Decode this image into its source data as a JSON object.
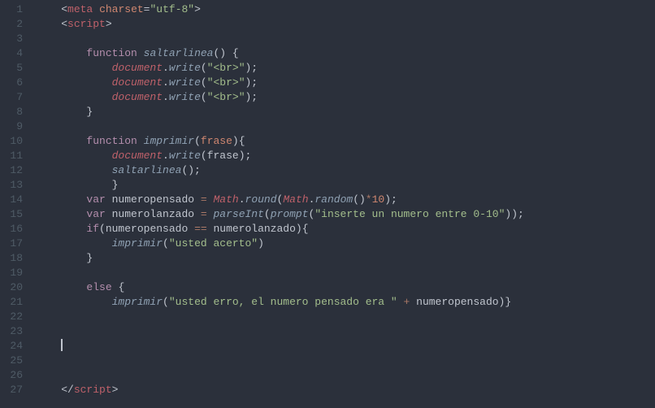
{
  "lineNumbers": [
    "1",
    "2",
    "3",
    "4",
    "5",
    "6",
    "7",
    "8",
    "9",
    "10",
    "11",
    "12",
    "13",
    "14",
    "15",
    "16",
    "17",
    "18",
    "19",
    "20",
    "21",
    "22",
    "23",
    "24",
    "25",
    "26",
    "27"
  ],
  "cursorLine": 24,
  "code": {
    "lines": [
      {
        "indent": 1,
        "tokens": [
          {
            "t": "<",
            "c": "punct"
          },
          {
            "t": "meta",
            "c": "tag"
          },
          {
            "t": " ",
            "c": "white"
          },
          {
            "t": "charset",
            "c": "attr"
          },
          {
            "t": "=",
            "c": "punct"
          },
          {
            "t": "\"utf-8\"",
            "c": "str"
          },
          {
            "t": ">",
            "c": "punct"
          }
        ]
      },
      {
        "indent": 1,
        "tokens": [
          {
            "t": "<",
            "c": "punct"
          },
          {
            "t": "script",
            "c": "tag"
          },
          {
            "t": ">",
            "c": "punct"
          }
        ]
      },
      {
        "indent": 0,
        "tokens": []
      },
      {
        "indent": 2,
        "tokens": [
          {
            "t": "function",
            "c": "kw"
          },
          {
            "t": " ",
            "c": "white"
          },
          {
            "t": "saltarlinea",
            "c": "fname"
          },
          {
            "t": "() {",
            "c": "punct"
          }
        ]
      },
      {
        "indent": 3,
        "tokens": [
          {
            "t": "document",
            "c": "obj"
          },
          {
            "t": ".",
            "c": "punct"
          },
          {
            "t": "write",
            "c": "prop"
          },
          {
            "t": "(",
            "c": "punct"
          },
          {
            "t": "\"<br>\"",
            "c": "str"
          },
          {
            "t": ");",
            "c": "punct"
          }
        ]
      },
      {
        "indent": 3,
        "tokens": [
          {
            "t": "document",
            "c": "obj"
          },
          {
            "t": ".",
            "c": "punct"
          },
          {
            "t": "write",
            "c": "prop"
          },
          {
            "t": "(",
            "c": "punct"
          },
          {
            "t": "\"<br>\"",
            "c": "str"
          },
          {
            "t": ");",
            "c": "punct"
          }
        ]
      },
      {
        "indent": 3,
        "tokens": [
          {
            "t": "document",
            "c": "obj"
          },
          {
            "t": ".",
            "c": "punct"
          },
          {
            "t": "write",
            "c": "prop"
          },
          {
            "t": "(",
            "c": "punct"
          },
          {
            "t": "\"<br>\"",
            "c": "str"
          },
          {
            "t": ");",
            "c": "punct"
          }
        ]
      },
      {
        "indent": 2,
        "tokens": [
          {
            "t": "}",
            "c": "punct"
          }
        ]
      },
      {
        "indent": 0,
        "tokens": []
      },
      {
        "indent": 2,
        "tokens": [
          {
            "t": "function",
            "c": "kw"
          },
          {
            "t": " ",
            "c": "white"
          },
          {
            "t": "imprimir",
            "c": "fname"
          },
          {
            "t": "(",
            "c": "punct"
          },
          {
            "t": "frase",
            "c": "param"
          },
          {
            "t": "){",
            "c": "punct"
          }
        ]
      },
      {
        "indent": 3,
        "tokens": [
          {
            "t": "document",
            "c": "obj"
          },
          {
            "t": ".",
            "c": "punct"
          },
          {
            "t": "write",
            "c": "prop"
          },
          {
            "t": "(",
            "c": "punct"
          },
          {
            "t": "frase",
            "c": "var"
          },
          {
            "t": ");",
            "c": "punct"
          }
        ]
      },
      {
        "indent": 3,
        "tokens": [
          {
            "t": "saltarlinea",
            "c": "fname"
          },
          {
            "t": "();",
            "c": "punct"
          }
        ]
      },
      {
        "indent": 3,
        "tokens": [
          {
            "t": "}",
            "c": "punct"
          }
        ]
      },
      {
        "indent": 2,
        "tokens": [
          {
            "t": "var",
            "c": "kw"
          },
          {
            "t": " numeropensado ",
            "c": "var"
          },
          {
            "t": "=",
            "c": "op"
          },
          {
            "t": " ",
            "c": "white"
          },
          {
            "t": "Math",
            "c": "obj"
          },
          {
            "t": ".",
            "c": "punct"
          },
          {
            "t": "round",
            "c": "prop"
          },
          {
            "t": "(",
            "c": "punct"
          },
          {
            "t": "Math",
            "c": "obj"
          },
          {
            "t": ".",
            "c": "punct"
          },
          {
            "t": "random",
            "c": "prop"
          },
          {
            "t": "()",
            "c": "punct"
          },
          {
            "t": "*",
            "c": "op"
          },
          {
            "t": "10",
            "c": "num"
          },
          {
            "t": ");",
            "c": "punct"
          }
        ]
      },
      {
        "indent": 2,
        "tokens": [
          {
            "t": "var",
            "c": "kw"
          },
          {
            "t": " numerolanzado ",
            "c": "var"
          },
          {
            "t": "=",
            "c": "op"
          },
          {
            "t": " ",
            "c": "white"
          },
          {
            "t": "parseInt",
            "c": "builtin"
          },
          {
            "t": "(",
            "c": "punct"
          },
          {
            "t": "prompt",
            "c": "builtin"
          },
          {
            "t": "(",
            "c": "punct"
          },
          {
            "t": "\"inserte un numero entre 0-10\"",
            "c": "str"
          },
          {
            "t": "));",
            "c": "punct"
          }
        ]
      },
      {
        "indent": 2,
        "tokens": [
          {
            "t": "if",
            "c": "kw"
          },
          {
            "t": "(numeropensado ",
            "c": "var"
          },
          {
            "t": "==",
            "c": "op"
          },
          {
            "t": " numerolanzado){",
            "c": "var"
          }
        ]
      },
      {
        "indent": 3,
        "tokens": [
          {
            "t": "imprimir",
            "c": "fname"
          },
          {
            "t": "(",
            "c": "punct"
          },
          {
            "t": "\"usted acerto\"",
            "c": "str"
          },
          {
            "t": ")",
            "c": "punct"
          }
        ]
      },
      {
        "indent": 2,
        "tokens": [
          {
            "t": "}",
            "c": "punct"
          }
        ]
      },
      {
        "indent": 0,
        "tokens": []
      },
      {
        "indent": 2,
        "tokens": [
          {
            "t": "else",
            "c": "kw"
          },
          {
            "t": " {",
            "c": "punct"
          }
        ]
      },
      {
        "indent": 3,
        "tokens": [
          {
            "t": "imprimir",
            "c": "fname"
          },
          {
            "t": "(",
            "c": "punct"
          },
          {
            "t": "\"usted erro, el numero pensado era \"",
            "c": "str"
          },
          {
            "t": " ",
            "c": "white"
          },
          {
            "t": "+",
            "c": "op"
          },
          {
            "t": " numeropensado)}",
            "c": "var"
          }
        ]
      },
      {
        "indent": 0,
        "tokens": []
      },
      {
        "indent": 0,
        "tokens": []
      },
      {
        "indent": 1,
        "tokens": [],
        "cursor": true
      },
      {
        "indent": 0,
        "tokens": []
      },
      {
        "indent": 0,
        "tokens": []
      },
      {
        "indent": 1,
        "tokens": [
          {
            "t": "</",
            "c": "punct"
          },
          {
            "t": "script",
            "c": "tag"
          },
          {
            "t": ">",
            "c": "punct"
          }
        ]
      }
    ],
    "indentUnit": "    "
  }
}
